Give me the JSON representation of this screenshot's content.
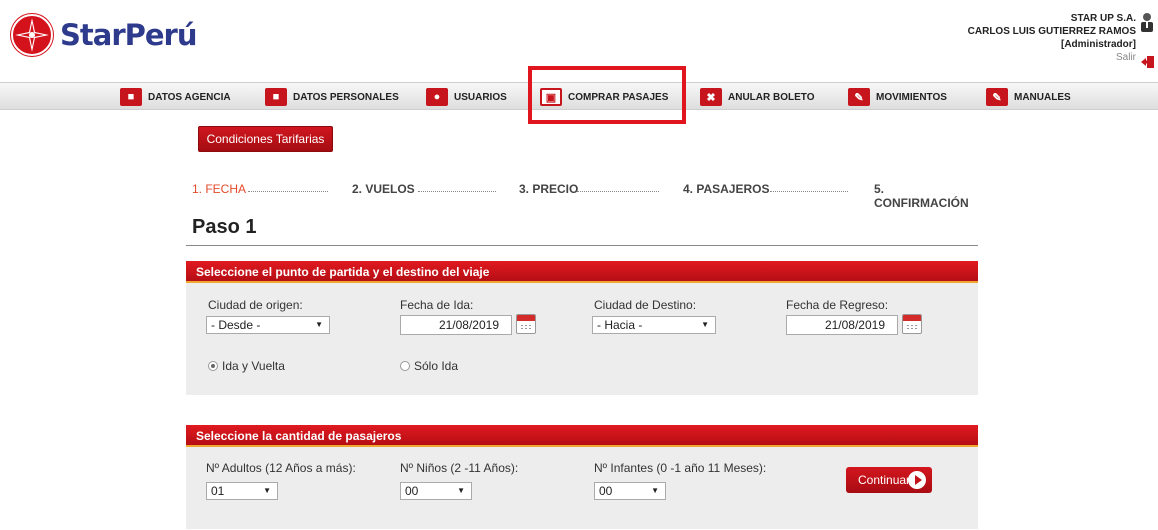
{
  "brand": {
    "name": "StarPerú",
    "color": "#d4121b",
    "text_color": "#2e3b8c"
  },
  "user": {
    "company": "STAR UP S.A.",
    "name": "CARLOS LUIS GUTIERREZ RAMOS",
    "role": "[Administrador]",
    "logout": "Salir"
  },
  "nav": {
    "items": [
      {
        "label": "DATOS AGENCIA",
        "icon": "agency-card-icon"
      },
      {
        "label": "DATOS PERSONALES",
        "icon": "personal-card-icon"
      },
      {
        "label": "USUARIOS",
        "icon": "users-icon"
      },
      {
        "label": "COMPRAR PASAJES",
        "icon": "shopping-cart-icon"
      },
      {
        "label": "ANULAR BOLETO",
        "icon": "cancel-ticket-icon"
      },
      {
        "label": "MOVIMIENTOS",
        "icon": "edit-pencil-icon"
      },
      {
        "label": "MANUALES",
        "icon": "manual-edit-icon"
      }
    ],
    "highlighted": "COMPRAR PASAJES"
  },
  "buttons": {
    "conditions": "Condiciones Tarifarias",
    "continue": "Continuar"
  },
  "steps": [
    "1. FECHA",
    "2. VUELOS",
    "3. PRECIO",
    "4. PASAJEROS",
    "5. CONFIRMACIÓN"
  ],
  "page_title": "Paso 1",
  "route_panel": {
    "title": "Seleccione el punto de partida y el destino del viaje",
    "origin_label": "Ciudad de origen:",
    "origin_value": "- Desde -",
    "departure_label": "Fecha de Ida:",
    "departure_value": "21/08/2019",
    "destination_label": "Ciudad de Destino:",
    "destination_value": "- Hacia -",
    "return_label": "Fecha de Regreso:",
    "return_value": "21/08/2019",
    "round_trip_label": "Ida y Vuelta",
    "one_way_label": "Sólo Ida"
  },
  "passengers_panel": {
    "title": "Seleccione la cantidad de pasajeros",
    "adults_label": "Nº Adultos (12 Años a más):",
    "adults_value": "01",
    "children_label": "Nº Niños (2 -11 Años):",
    "children_value": "00",
    "infants_label": "Nº Infantes (0 -1 año 11 Meses):",
    "infants_value": "00"
  }
}
